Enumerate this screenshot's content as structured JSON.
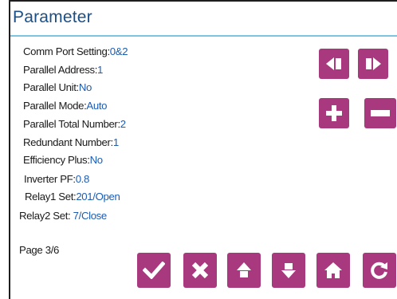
{
  "title": "Parameter",
  "parameters": [
    {
      "label": "Comm Port Setting:",
      "value": "0&2"
    },
    {
      "label": "Parallel Address:",
      "value": "1"
    },
    {
      "label": "Parallel Unit:",
      "value": "No"
    },
    {
      "label": "Parallel Mode:",
      "value": "Auto"
    },
    {
      "label": "Parallel Total Number:",
      "value": "2"
    },
    {
      "label": "Redundant Number:",
      "value": "1"
    },
    {
      "label": "Efficiency Plus:",
      "value": "No"
    },
    {
      "label": "Inverter PF:",
      "value": "0.8"
    },
    {
      "label": "Relay1 Set:",
      "value": "201/Open"
    },
    {
      "label": "Relay2 Set: ",
      "value": "7/Close"
    }
  ],
  "page_indicator": "Page 3/6",
  "buttons": {
    "prev": "left-arrow-icon",
    "next": "right-arrow-icon",
    "increase": "plus-icon",
    "decrease": "minus-icon",
    "confirm": "check-icon",
    "cancel": "x-icon",
    "up": "up-arrow-icon",
    "down": "down-arrow-icon",
    "home": "home-icon",
    "refresh": "refresh-icon"
  },
  "colors": {
    "title": "#1b4f87",
    "value": "#1c5cb3",
    "button": "#a8397f",
    "rule": "#7ec3df"
  }
}
